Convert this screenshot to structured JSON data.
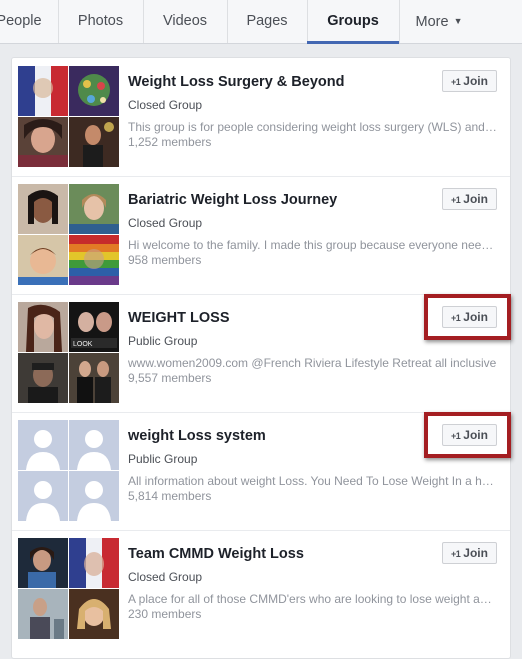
{
  "tabs": [
    {
      "label": "People"
    },
    {
      "label": "Photos"
    },
    {
      "label": "Videos"
    },
    {
      "label": "Pages"
    },
    {
      "label": "Groups",
      "active": true
    },
    {
      "label": "More",
      "icon": "caret-down-icon"
    }
  ],
  "groups": [
    {
      "name": "Weight Loss Surgery & Beyond",
      "privacy": "Closed Group",
      "description": "This group is for people considering weight loss surgery (WLS) and beyond",
      "members": "1,252 members",
      "join_label": "Join",
      "join_prefix": "+1"
    },
    {
      "name": "Bariatric Weight Loss Journey",
      "privacy": "Closed Group",
      "description": "Hi welcome to the family. I made this group because everyone needs support",
      "members": "958 members",
      "join_label": "Join",
      "join_prefix": "+1"
    },
    {
      "name": "WEIGHT LOSS",
      "privacy": "Public Group",
      "description": "www.women2009.com @French Riviera Lifestyle Retreat all inclusive",
      "members": "9,557 members",
      "join_label": "Join",
      "join_prefix": "+1",
      "highlighted": true
    },
    {
      "name": "weight Loss system",
      "privacy": "Public Group",
      "description": "All information about weight Loss. You Need To Lose Weight In a healthy way",
      "members": "5,814 members",
      "join_label": "Join",
      "join_prefix": "+1",
      "highlighted": true
    },
    {
      "name": "Team CMMD Weight Loss",
      "privacy": "Closed Group",
      "description": "A place for all of those CMMD'ers who are looking to lose weight and keep it off",
      "members": "230 members",
      "join_label": "Join",
      "join_prefix": "+1"
    }
  ],
  "colors": {
    "accent": "#4267b2",
    "highlight_border": "#a41e22",
    "default_avatar_bg": "#c4cde0"
  }
}
